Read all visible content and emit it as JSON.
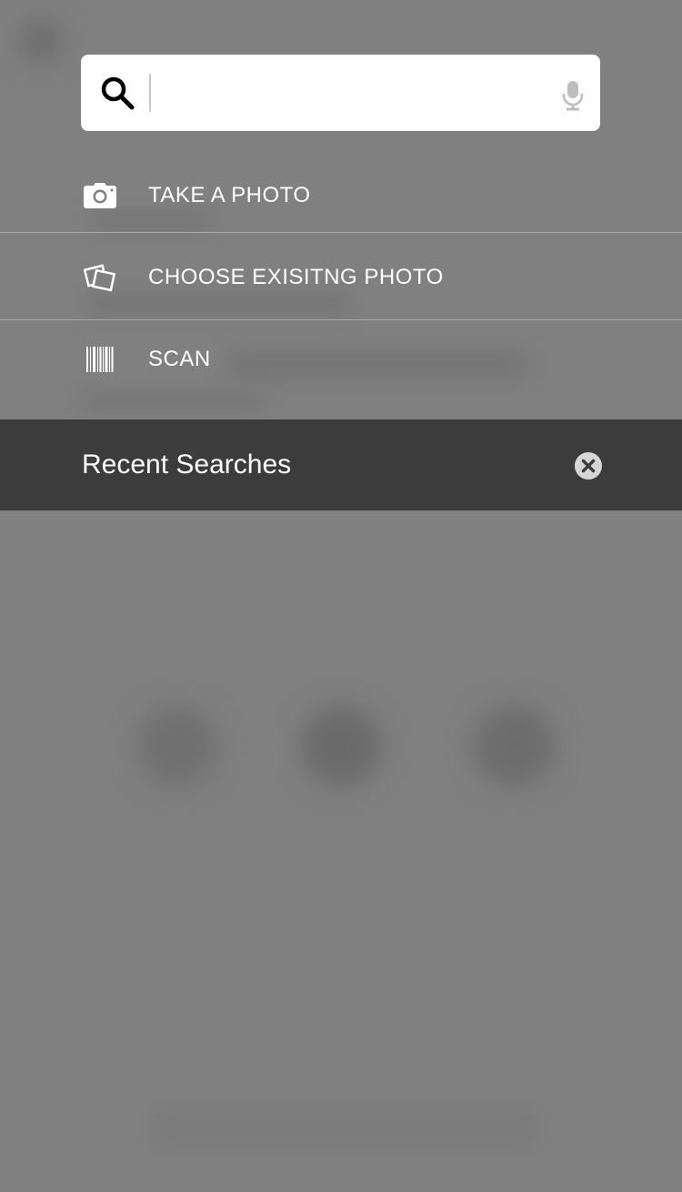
{
  "search": {
    "value": "",
    "placeholder": ""
  },
  "menu": {
    "items": [
      {
        "icon": "camera-icon",
        "label": "TAKE A PHOTO"
      },
      {
        "icon": "photos-icon",
        "label": "CHOOSE EXISITNG PHOTO"
      },
      {
        "icon": "barcode-icon",
        "label": "SCAN"
      }
    ]
  },
  "recent": {
    "title": "Recent Searches",
    "clear_icon": "close-circle-icon"
  },
  "colors": {
    "overlay": "#808080",
    "recent_bar": "#3c3c3c",
    "text": "#ffffff"
  }
}
